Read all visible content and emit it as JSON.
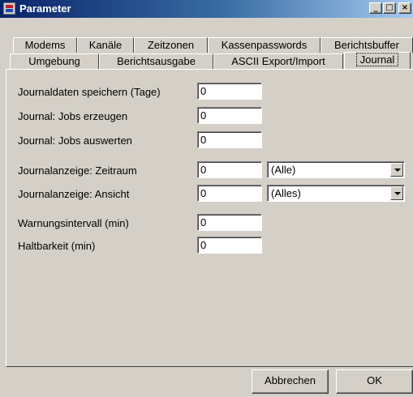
{
  "window": {
    "title": "Parameter",
    "minimize": "_",
    "maximize": "□",
    "close": "×"
  },
  "tabs_row1": [
    "Modems",
    "Kanäle",
    "Zeitzonen",
    "Kassenpasswords",
    "Berichtsbuffer"
  ],
  "tabs_row2": [
    "Umgebung",
    "Berichtsausgabe",
    "ASCII Export/Import",
    "Journal"
  ],
  "active_tab": "Journal",
  "fields": [
    {
      "label": "Journaldaten speichern (Tage)",
      "value": "0"
    },
    {
      "label": "Journal: Jobs erzeugen",
      "value": "0"
    },
    {
      "label": "Journal: Jobs auswerten",
      "value": "0"
    },
    {
      "label": "Journalanzeige: Zeitraum",
      "value": "0",
      "combo": "(Alle)"
    },
    {
      "label": "Journalanzeige: Ansicht",
      "value": "0",
      "combo": "(Alles)"
    },
    {
      "label": "Warnungsintervall (min)",
      "value": "0"
    },
    {
      "label": "Haltbarkeit (min)",
      "value": "0"
    }
  ],
  "buttons": {
    "cancel": "Abbrechen",
    "ok": "OK"
  }
}
